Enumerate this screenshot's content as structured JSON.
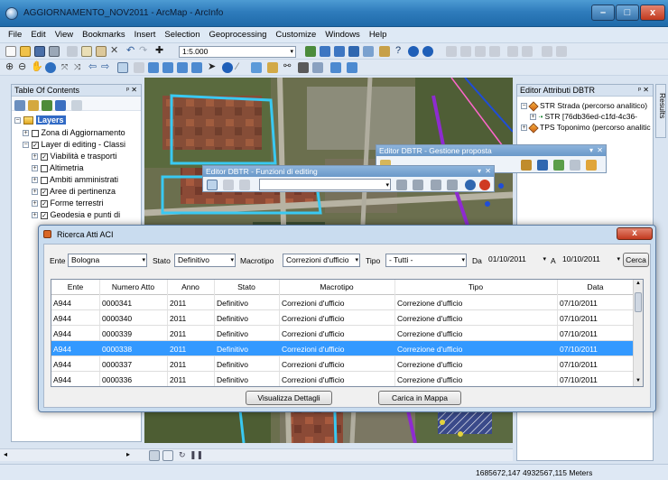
{
  "window": {
    "title": "AGGIORNAMENTO_NOV2011 - ArcMap - ArcInfo",
    "minimize": "–",
    "maximize": "□",
    "close": "x"
  },
  "menu": [
    "File",
    "Edit",
    "View",
    "Bookmarks",
    "Insert",
    "Selection",
    "Geoprocessing",
    "Customize",
    "Windows",
    "Help"
  ],
  "toolbar": {
    "scale": "1:5.000"
  },
  "toc": {
    "title": "Table Of Contents",
    "pin": "ᵖ ✕",
    "items": [
      {
        "label": "Layers",
        "checked": null,
        "expanded": true
      },
      {
        "label": "Zona di Aggiornamento",
        "checked": false
      },
      {
        "label": "Layer di editing - Classi",
        "checked": true
      },
      {
        "label": "Viabilità e trasporti",
        "checked": true
      },
      {
        "label": "Altimetria",
        "checked": false
      },
      {
        "label": "Ambiti amministrati",
        "checked": false
      },
      {
        "label": "Aree di pertinenza",
        "checked": true
      },
      {
        "label": "Forme terrestri",
        "checked": true
      },
      {
        "label": "Geodesia e punti di",
        "checked": true
      }
    ]
  },
  "right_panel": {
    "title": "Editor Attributi DBTR",
    "pin": "ᵖ ✕",
    "items": [
      "STR Strada (percorso analitico)",
      "STR [76db36ed-c1fd-4c36-",
      "TPS Toponimo (percorso analitic"
    ],
    "results_tab": "Results"
  },
  "floating": {
    "gestione_title": "Editor DBTR - Gestione proposta",
    "funzioni_title": "Editor DBTR - Funzioni di editing",
    "close": "✕",
    "menu": "▾"
  },
  "dialog": {
    "title": "Ricerca Atti ACI",
    "close": "x",
    "filters": {
      "ente_label": "Ente",
      "ente_value": "Bologna",
      "stato_label": "Stato",
      "stato_value": "Definitivo",
      "macrotipo_label": "Macrotipo",
      "macrotipo_value": "Correzioni d'ufficio",
      "tipo_label": "Tipo",
      "tipo_value": "- Tutti -",
      "da_label": "Da",
      "da_value": "01/10/2011",
      "a_label": "A",
      "a_value": "10/10/2011",
      "search_button": "Cerca"
    },
    "columns": [
      "Ente",
      "Numero Atto",
      "Anno",
      "Stato",
      "Macrotipo",
      "Tipo",
      "Data"
    ],
    "rows": [
      [
        "A944",
        "0000341",
        "2011",
        "Definitivo",
        "Correzioni d'ufficio",
        "Correzione d'ufficio",
        "07/10/2011"
      ],
      [
        "A944",
        "0000340",
        "2011",
        "Definitivo",
        "Correzioni d'ufficio",
        "Correzione d'ufficio",
        "07/10/2011"
      ],
      [
        "A944",
        "0000339",
        "2011",
        "Definitivo",
        "Correzioni d'ufficio",
        "Correzione d'ufficio",
        "07/10/2011"
      ],
      [
        "A944",
        "0000338",
        "2011",
        "Definitivo",
        "Correzioni d'ufficio",
        "Correzione d'ufficio",
        "07/10/2011"
      ],
      [
        "A944",
        "0000337",
        "2011",
        "Definitivo",
        "Correzioni d'ufficio",
        "Correzione d'ufficio",
        "07/10/2011"
      ],
      [
        "A944",
        "0000336",
        "2011",
        "Definitivo",
        "Correzioni d'ufficio",
        "Correzione d'ufficio",
        "07/10/2011"
      ]
    ],
    "selected_row": 3,
    "details_button": "Visualizza Dettagli",
    "map_button": "Carica in Mappa"
  },
  "status": {
    "coordinates": "1685672,147  4932567,115 Meters"
  },
  "colors": {
    "selection": "#3399ff",
    "titlebar": "#2f7cbc",
    "road_highlight": "#39c9f2",
    "boundary": "#8e2bd0"
  }
}
